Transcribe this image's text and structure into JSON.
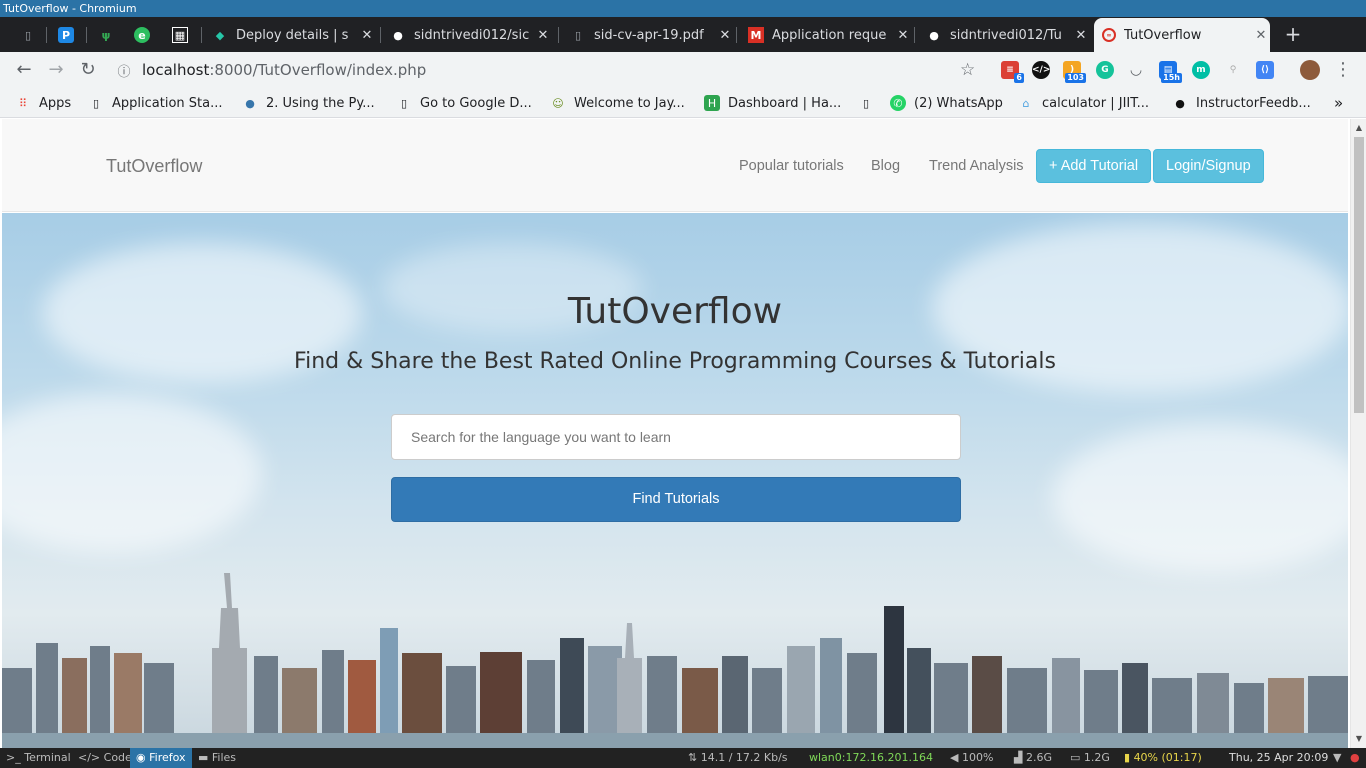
{
  "window": {
    "title": "TutOverflow - Chromium"
  },
  "tabs": [
    {
      "label": "",
      "icon": "file-icon"
    },
    {
      "label": "",
      "icon": "pycharm-icon"
    },
    {
      "label": "",
      "icon": "plant-icon"
    },
    {
      "label": "",
      "icon": "evernote-icon"
    },
    {
      "label": "",
      "icon": "qr-icon"
    },
    {
      "label": "Deploy details | s",
      "icon": "netlify-icon"
    },
    {
      "label": "sidntrivedi012/sic",
      "icon": "github-icon"
    },
    {
      "label": "sid-cv-apr-19.pdf",
      "icon": "file-icon"
    },
    {
      "label": "Application reque",
      "icon": "gmail-icon"
    },
    {
      "label": "sidntrivedi012/Tu",
      "icon": "github-icon"
    },
    {
      "label": "TutOverflow",
      "icon": "site-icon",
      "active": true
    }
  ],
  "toolbar": {
    "url_host": "localhost",
    "url_path": ":8000/TutOverflow/index.php",
    "extension_badges": {
      "todoist": "6",
      "feed": "103",
      "clock": "15h"
    }
  },
  "bookmarks": [
    {
      "label": "Apps",
      "icon": "apps-grid-icon"
    },
    {
      "label": "Application Sta...",
      "icon": "page-icon"
    },
    {
      "label": "2. Using the Py...",
      "icon": "python-icon"
    },
    {
      "label": "Go to Google D...",
      "icon": "page-icon"
    },
    {
      "label": "Welcome to Jay...",
      "icon": "avatar-icon"
    },
    {
      "label": "Dashboard | Ha...",
      "icon": "hackerearth-icon"
    },
    {
      "label": "",
      "icon": "page-icon"
    },
    {
      "label": "(2) WhatsApp",
      "icon": "whatsapp-icon"
    },
    {
      "label": "calculator | JIIT...",
      "icon": "jiit-icon"
    },
    {
      "label": "InstructorFeedb...",
      "icon": "github-icon"
    }
  ],
  "site": {
    "brand": "TutOverflow",
    "nav": [
      "Popular tutorials",
      "Blog",
      "Trend Analysis"
    ],
    "add_tutorial": "+ Add Tutorial",
    "login": "Login/Signup",
    "hero_title": "TutOverflow",
    "hero_subtitle": "Find & Share the Best Rated Online Programming Courses & Tutorials",
    "search_placeholder": "Search for the language you want to learn",
    "find_button": "Find Tutorials"
  },
  "panel": {
    "terminal": "Terminal",
    "code": "Code",
    "firefox": "Firefox",
    "files": "Files",
    "net_speed": "14.1 / 17.2 Kb/s",
    "wlan": "wlan0:172.16.201.164",
    "volume": "100%",
    "mem": "2.6G",
    "disk": "1.2G",
    "battery": "40% (01:17)",
    "datetime": "Thu, 25 Apr 20:09"
  },
  "colors": {
    "accent": "#337ab7",
    "info": "#5bc0de",
    "wlan_text": "#7fd858",
    "battery_text": "#e8d54a"
  }
}
